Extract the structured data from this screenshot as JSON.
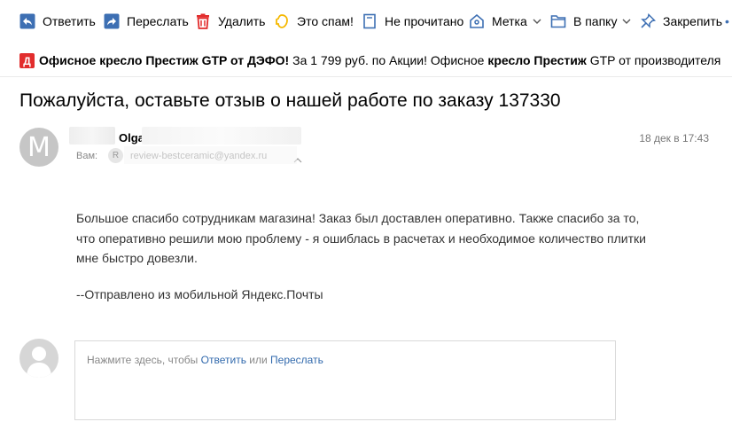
{
  "toolbar": {
    "reply": "Ответить",
    "forward": "Переслать",
    "delete": "Удалить",
    "spam": "Это спам!",
    "unread": "Не прочитано",
    "label": "Метка",
    "folder": "В папку",
    "pin": "Закрепить"
  },
  "ad": {
    "badge": "Д",
    "title": "Офисное кресло Престиж GTP от ДЭФО!",
    "text1": " За 1 799 руб. по Акции! Офисное ",
    "bold2": "кресло Престиж",
    "text2": " GTP от производителя"
  },
  "message": {
    "subject": "Пожалуйста, оставьте отзыв о нашей работе по заказу 137330",
    "sender_initial": "M",
    "sender_name": "Olga",
    "date": "18 дек в 17:43",
    "to_label": "Вам:",
    "to_avatar_letter": "R",
    "to_email": "review-bestceramic@yandex.ru",
    "body_lines": [
      "Большое спасибо сотрудникам магазина! Заказ был доставлен оперативно. Также спасибо за то,",
      "что оперативно решили мою проблему - я ошиблась в расчетах и необходимое количество плитки",
      "мне быстро довезли."
    ],
    "signature": "--Отправлено из мобильной Яндекс.Почты"
  },
  "reply": {
    "hint_prefix": "Нажмите здесь, чтобы ",
    "reply_link": "Ответить",
    "or": " или ",
    "forward_link": "Переслать"
  },
  "colors": {
    "accent": "#326aad",
    "delete_red": "#e22d2d",
    "spam_yellow": "#f5b800",
    "icon_blue": "#3d6fb3"
  }
}
